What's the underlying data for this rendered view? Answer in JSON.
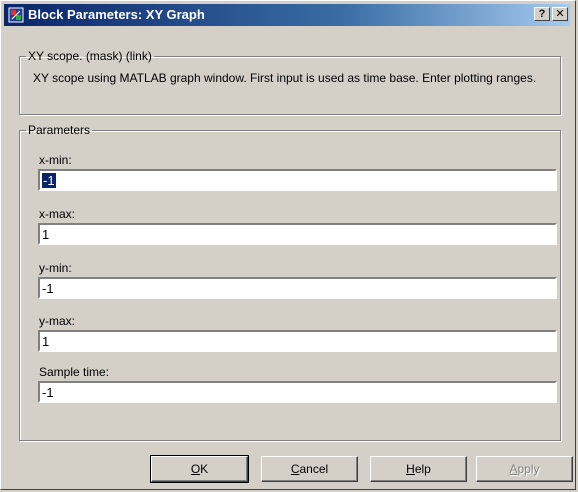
{
  "window": {
    "title": "Block Parameters: XY Graph",
    "help_button": "?",
    "close_button": "✕"
  },
  "description_group": {
    "legend": "XY scope. (mask) (link)",
    "text": "XY scope using MATLAB graph window.  First input is used as time base.  Enter plotting ranges."
  },
  "parameters_group": {
    "legend": "Parameters",
    "fields": [
      {
        "label": "x-min:",
        "value": "-1",
        "selected": true
      },
      {
        "label": "x-max:",
        "value": "1"
      },
      {
        "label": "y-min:",
        "value": "-1"
      },
      {
        "label": "y-max:",
        "value": "1"
      },
      {
        "label": "Sample time:",
        "value": "-1"
      }
    ]
  },
  "buttons": {
    "ok": {
      "mnemonic": "O",
      "rest": "K"
    },
    "cancel": {
      "mnemonic": "C",
      "rest": "ancel"
    },
    "help": {
      "mnemonic": "H",
      "rest": "elp"
    },
    "apply": {
      "mnemonic": "A",
      "rest": "pply",
      "enabled": false
    }
  }
}
